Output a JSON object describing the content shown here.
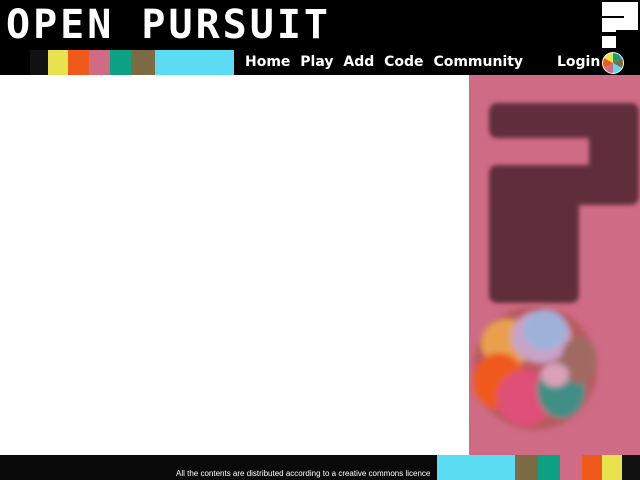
{
  "header": {
    "logo_text": "OPEN PURSUIT"
  },
  "nav": {
    "links": [
      "Home",
      "Play",
      "Add",
      "Code",
      "Community"
    ],
    "login_label": "Login"
  },
  "footer": {
    "notice": "All the contents are distributed according to a creative commons licence"
  },
  "colors": {
    "black": "#000000",
    "yellow": "#e8e24c",
    "orange": "#ef5a1b",
    "pink": "#cf6b85",
    "teal": "#0ca084",
    "olive": "#7c6b45",
    "cyan": "#5cdcf3",
    "dark_plum": "#612d3b"
  },
  "icons": {
    "logo": "question-mark-logo-icon",
    "wheel": "color-wheel-icon",
    "panel_graphic": "question-mark-ball-illustration"
  }
}
